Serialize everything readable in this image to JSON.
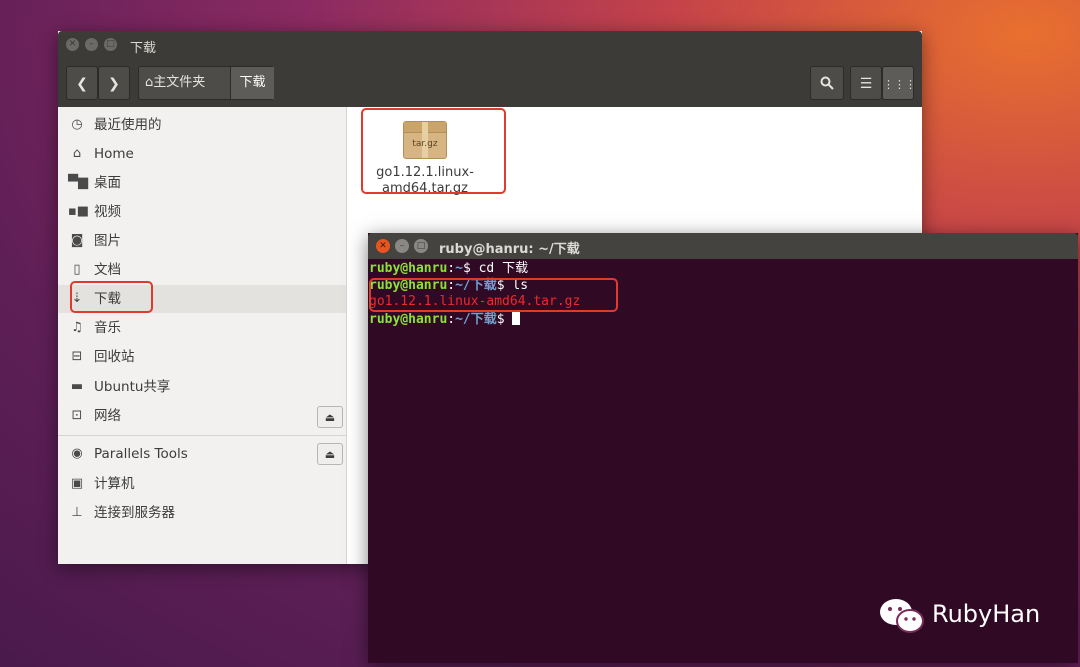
{
  "file_manager": {
    "title": "下载",
    "breadcrumb": {
      "home_label": "主文件夹",
      "current": "下载"
    },
    "sidebar": {
      "items": [
        {
          "label": "最近使用的",
          "icon": "clock-icon"
        },
        {
          "label": "Home",
          "icon": "home-icon"
        },
        {
          "label": "桌面",
          "icon": "folder-icon"
        },
        {
          "label": "视频",
          "icon": "video-icon"
        },
        {
          "label": "图片",
          "icon": "camera-icon"
        },
        {
          "label": "文档",
          "icon": "document-icon"
        },
        {
          "label": "下载",
          "icon": "download-icon",
          "selected": true
        },
        {
          "label": "音乐",
          "icon": "music-icon"
        },
        {
          "label": "回收站",
          "icon": "trash-icon"
        },
        {
          "label": "Ubuntu共享",
          "icon": "drive-icon",
          "eject": true
        },
        {
          "label": "网络",
          "icon": "network-icon"
        }
      ],
      "devices": [
        {
          "label": "Parallels Tools",
          "icon": "disc-icon",
          "eject": true
        },
        {
          "label": "计算机",
          "icon": "computer-icon"
        },
        {
          "label": "连接到服务器",
          "icon": "server-icon"
        }
      ]
    },
    "files": [
      {
        "name_line1": "go1.12.1.linux-",
        "name_line2": "amd64.tar.gz",
        "icon_label": "tar.gz"
      }
    ]
  },
  "terminal": {
    "title": "ruby@hanru: ~/下载",
    "lines": [
      {
        "user": "ruby@hanru",
        "path": "~",
        "cmd": " cd 下载"
      },
      {
        "user": "ruby@hanru",
        "path": "~/下载",
        "cmd": " ls"
      },
      {
        "output": "go1.12.1.linux-amd64.tar.gz"
      },
      {
        "user": "ruby@hanru",
        "path": "~/下载",
        "cmd": " "
      }
    ]
  },
  "watermark": {
    "text": "RubyHan"
  },
  "colors": {
    "terminal_bg": "#300a24",
    "prompt_user": "#8ae234",
    "prompt_path": "#729fcf",
    "highlight_box": "#e03a2e",
    "close_button": "#e95420"
  }
}
